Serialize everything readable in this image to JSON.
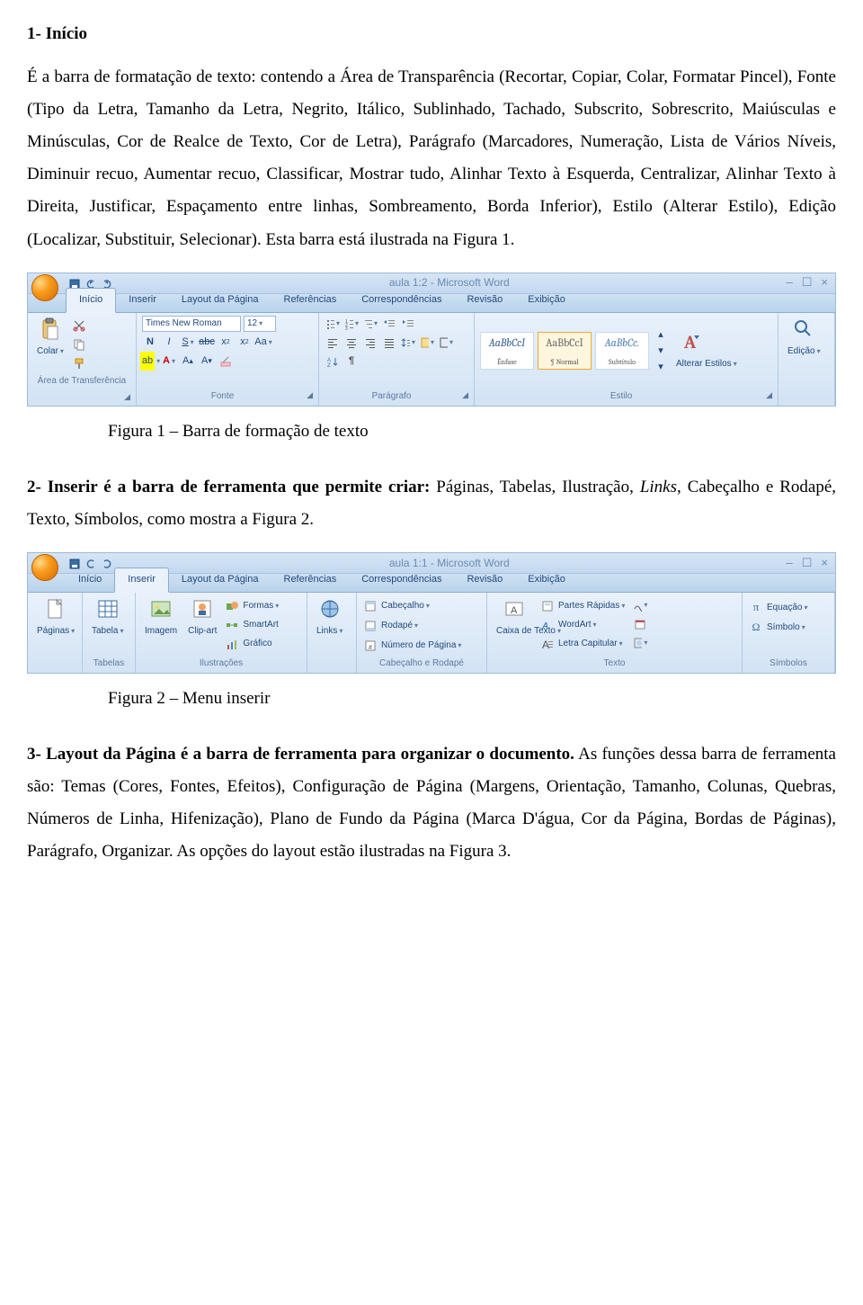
{
  "doc": {
    "h1": "1- Início",
    "p1": "É a barra de formatação de texto: contendo a Área de Transparência (Recortar, Copiar, Colar, Formatar Pincel), Fonte (Tipo da Letra, Tamanho da Letra, Negrito, Itálico, Sublinhado, Tachado, Subscrito, Sobrescrito, Maiúsculas e Minúsculas, Cor de Realce de Texto, Cor de Letra), Parágrafo (Marcadores, Numeração, Lista de Vários Níveis, Diminuir recuo, Aumentar recuo, Classificar, Mostrar tudo, Alinhar Texto à Esquerda, Centralizar, Alinhar Texto à Direita, Justificar, Espaçamento entre linhas, Sombreamento, Borda Inferior), Estilo (Alterar Estilo), Edição (Localizar, Substituir, Selecionar). Esta barra está ilustrada na Figura 1.",
    "cap1": "Figura 1 – Barra de formação de texto",
    "h2b": "2- Inserir é a barra de ferramenta que permite criar:",
    "h2r": " Páginas, Tabelas, Ilustração, ",
    "h2i": "Links",
    "h2r2": ", Cabeçalho e Rodapé, Texto, Símbolos, como mostra a Figura 2.",
    "cap2": "Figura 2 – Menu inserir",
    "h3b": "3- Layout da Página é a barra de ferramenta para organizar o documento.",
    "h3r": " As funções dessa barra de ferramenta são: Temas (Cores, Fontes, Efeitos), Configuração de Página (Margens, Orientação, Tamanho, Colunas, Quebras, Números de Linha, Hifenização), Plano de Fundo da Página (Marca D'água, Cor da Página, Bordas de Páginas), Parágrafo, Organizar. As opções do layout estão ilustradas na Figura 3."
  },
  "rb1": {
    "title": "aula 1:2 - Microsoft Word",
    "tabs": [
      "Início",
      "Inserir",
      "Layout da Página",
      "Referências",
      "Correspondências",
      "Revisão",
      "Exibição"
    ],
    "active": 0,
    "g_area": {
      "title": "Área de Transferência",
      "colar": "Colar"
    },
    "g_fonte": {
      "title": "Fonte",
      "font": "Times New Roman",
      "size": "12"
    },
    "g_para": {
      "title": "Parágrafo"
    },
    "g_estilo": {
      "title": "Estilo",
      "s1": {
        "s": "AaBbCcI",
        "n": "Ênfase"
      },
      "s2": {
        "s": "AaBbCcI",
        "n": "¶ Normal"
      },
      "s3": {
        "s": "AaBbCc.",
        "n": "Subtítulo"
      },
      "alterar": "Alterar Estilos"
    },
    "g_edicao": {
      "title": "",
      "label": "Edição"
    }
  },
  "rb2": {
    "title": "aula 1:1 - Microsoft Word",
    "tabs": [
      "Início",
      "Inserir",
      "Layout da Página",
      "Referências",
      "Correspondências",
      "Revisão",
      "Exibição"
    ],
    "active": 1,
    "g_paginas": {
      "title": "",
      "label": "Páginas"
    },
    "g_tabelas": {
      "title": "Tabelas",
      "label": "Tabela"
    },
    "g_ilust": {
      "title": "Ilustrações",
      "imagem": "Imagem",
      "clipart": "Clip-art",
      "formas": "Formas",
      "smartart": "SmartArt",
      "grafico": "Gráfico"
    },
    "g_links": {
      "title": "",
      "label": "Links"
    },
    "g_cabrod": {
      "title": "Cabeçalho e Rodapé",
      "cab": "Cabeçalho",
      "rod": "Rodapé",
      "num": "Número de Página"
    },
    "g_texto": {
      "title": "Texto",
      "caixa": "Caixa de Texto",
      "partes": "Partes Rápidas",
      "wordart": "WordArt",
      "capitular": "Letra Capitular"
    },
    "g_simb": {
      "title": "Símbolos",
      "eq": "Equação",
      "simb": "Símbolo"
    }
  }
}
